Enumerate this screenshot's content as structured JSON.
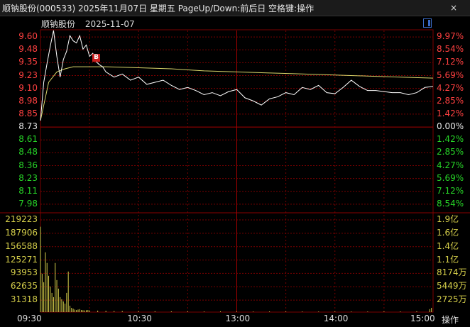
{
  "window": {
    "title": "顺钠股份(000533) 2025年11月07日 星期五 PageUp/Down:前后日 空格键:操作",
    "close_label": "×"
  },
  "header": {
    "stock_name": "顺钠股份",
    "date": "2025-11-07"
  },
  "price_axis": {
    "left_labels": [
      "9.60",
      "9.48",
      "9.35",
      "9.23",
      "9.10",
      "8.98",
      "8.85",
      "8.73",
      "8.61",
      "8.48",
      "8.36",
      "8.23",
      "8.11",
      "7.98"
    ],
    "right_labels": [
      "9.97%",
      "8.54%",
      "7.12%",
      "5.69%",
      "4.27%",
      "2.85%",
      "1.42%",
      "0.00%",
      "1.42%",
      "2.85%",
      "4.27%",
      "5.69%",
      "7.12%",
      "8.54%"
    ],
    "base_price": 8.73
  },
  "volume_axis": {
    "left_labels": [
      "219223",
      "187906",
      "156588",
      "125271",
      "93953",
      "62635",
      "31318"
    ],
    "right_labels": [
      "1.9亿",
      "1.6亿",
      "1.4亿",
      "1.1亿",
      "8174万",
      "5449万",
      "2725万"
    ]
  },
  "time_axis": {
    "labels": [
      "09:30",
      "10:30",
      "13:00",
      "14:00",
      "15:00"
    ]
  },
  "toolbar": {
    "ops_label": "操作"
  },
  "marker": {
    "label": "B"
  },
  "colors": {
    "up": "#ff4040",
    "down": "#27d427",
    "grid": "#7a0000",
    "price_line": "#ffffff",
    "avg_line": "#d8d56a",
    "volume": "#d6cf4a"
  },
  "chart_data": {
    "type": "line",
    "x_unit": "minutes since 09:30 (trading minutes, 240 total)",
    "series": [
      {
        "x": [
          0,
          2,
          4,
          6,
          8,
          10,
          12,
          14,
          16,
          18,
          20,
          22,
          24,
          26,
          28,
          30,
          32,
          34,
          36,
          38,
          40,
          45,
          50,
          55,
          60,
          65,
          70,
          75,
          80,
          85,
          90,
          95,
          100,
          105,
          110,
          115,
          120,
          125,
          130,
          135,
          140,
          145,
          150,
          155,
          160,
          165,
          170,
          175,
          180,
          185,
          190,
          195,
          200,
          205,
          210,
          215,
          220,
          225,
          230,
          235,
          240
        ],
        "y": [
          8.73,
          9.1,
          9.28,
          9.45,
          9.6,
          9.35,
          9.15,
          9.32,
          9.4,
          9.55,
          9.5,
          9.48,
          9.55,
          9.42,
          9.46,
          9.35,
          9.38,
          9.3,
          9.27,
          9.25,
          9.2,
          9.15,
          9.18,
          9.12,
          9.15,
          9.08,
          9.1,
          9.12,
          9.07,
          9.03,
          9.05,
          9.02,
          8.98,
          9.0,
          8.97,
          9.01,
          9.03,
          8.95,
          8.92,
          8.88,
          8.94,
          8.96,
          9.0,
          8.98,
          9.05,
          9.03,
          9.07,
          9.0,
          8.99,
          9.05,
          9.12,
          9.06,
          9.02,
          9.02,
          9.01,
          9.0,
          9.0,
          8.98,
          9.0,
          9.05,
          9.06
        ]
      },
      {
        "x": [
          0,
          5,
          10,
          15,
          20,
          30,
          40,
          60,
          80,
          100,
          120,
          140,
          160,
          180,
          200,
          220,
          240
        ],
        "y": [
          8.73,
          9.1,
          9.2,
          9.23,
          9.25,
          9.25,
          9.25,
          9.24,
          9.23,
          9.21,
          9.2,
          9.19,
          9.18,
          9.17,
          9.16,
          9.15,
          9.14
        ]
      }
    ],
    "volume": {
      "x": [
        0,
        1,
        2,
        3,
        4,
        5,
        6,
        7,
        8,
        9,
        10,
        11,
        12,
        13,
        14,
        15,
        16,
        17,
        18,
        19,
        20,
        21,
        22,
        23,
        24,
        25,
        26,
        27,
        28,
        29,
        30,
        35,
        40,
        45,
        50,
        60,
        70,
        80,
        90,
        100,
        110,
        120,
        130,
        140,
        150,
        160,
        170,
        180,
        190,
        200,
        210,
        220,
        230,
        238,
        239
      ],
      "values": [
        200000,
        90000,
        70000,
        140000,
        115000,
        85000,
        60000,
        45000,
        35000,
        115000,
        75000,
        55000,
        35000,
        30000,
        25000,
        20000,
        45000,
        95000,
        15000,
        10000,
        8000,
        6000,
        5000,
        6000,
        7000,
        5000,
        4500,
        4000,
        4500,
        5000,
        4000,
        3500,
        3000,
        2500,
        2500,
        2000,
        2000,
        1800,
        1800,
        1500,
        1800,
        1500,
        1400,
        1500,
        1500,
        1400,
        1300,
        1500,
        1400,
        1300,
        1500,
        1500,
        2000,
        7000,
        10000
      ],
      "ylim": [
        0,
        219223
      ]
    },
    "ylim": [
      7.86,
      9.6
    ],
    "xlim": [
      0,
      240
    ]
  }
}
